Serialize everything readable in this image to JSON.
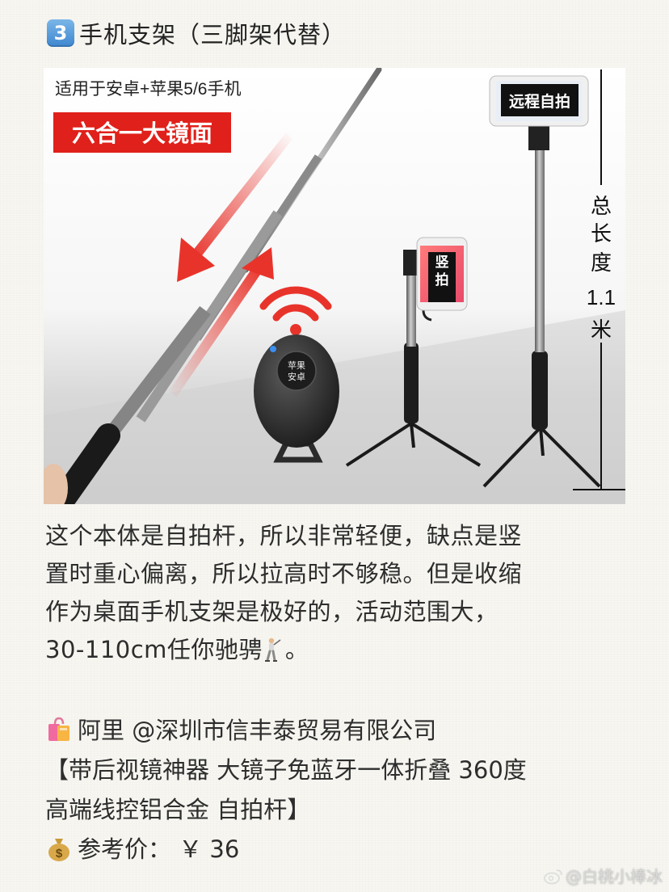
{
  "heading": {
    "number_badge": "3",
    "title": "手机支架（三脚架代替）"
  },
  "product_image": {
    "compat_text": "适用于安卓+苹果5/6手机",
    "mirror_banner": "六合一大镜面",
    "remote_button_label": "苹果\n安卓",
    "phone_small_label": "竖拍",
    "phone_large_label": "远程自拍",
    "length_label_chars": [
      "总",
      "长",
      "度"
    ],
    "length_value": "1.1",
    "length_unit": "米",
    "colors": {
      "banner_red": "#e0201a",
      "arrow_red": "#e8332b",
      "signal_red": "#e8332b"
    }
  },
  "description": {
    "lines": [
      "这个本体是自拍杆，所以非常轻便，缺点是竖",
      "置时重心偏离，所以拉高时不够稳。但是收缩",
      "作为桌面手机支架是极好的，活动范围大，",
      "30-110cm任你驰骋"
    ],
    "line4_suffix": "。",
    "icon": "golfer-icon"
  },
  "shop": {
    "seller": "阿里 @深圳市信丰泰贸易有限公司",
    "product_line1": "【带后视镜神器 大镜子免蓝牙一体折叠 360度",
    "product_line2": "高端线控铝合金 自拍杆】",
    "price": "参考价： ￥ 36",
    "icons": [
      "shopping-bag-icon",
      "money-bag-icon"
    ]
  },
  "watermark": {
    "text": "@白桃小棒冰",
    "icon": "weibo-icon"
  }
}
